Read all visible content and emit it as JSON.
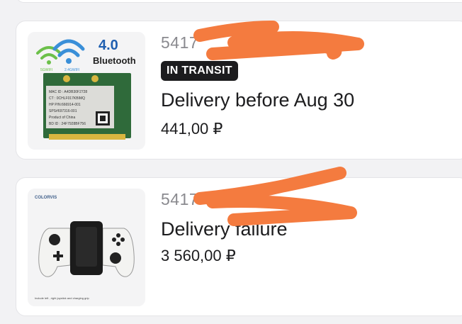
{
  "orders": [
    {
      "order_id": "5417",
      "status_badge": "IN TRANSIT",
      "delivery_text": "Delivery before Aug 30",
      "price": "441,00 ₽",
      "image": {
        "bluetooth_label": "Bluetooth",
        "bluetooth_version": "4.0",
        "wifi_5g": "5GWIFI",
        "wifi_24g": "2.4GWIFI",
        "card_lines": [
          "MAC ID : A4DB30F2728",
          "CT : 0CHLF017KBIMQ",
          "HP P/N:666914-001",
          "SPS#697316-001",
          "Product of China",
          "BD ID : 24F7928BF756"
        ]
      }
    },
    {
      "order_id": "5417",
      "delivery_text": "Delivery failure",
      "price": "3 560,00 ₽",
      "image": {
        "brand": "COLORVIS",
        "caption": "Include left , right joystick and charging grip"
      }
    }
  ],
  "colors": {
    "redaction": "#f47b3f",
    "badge_bg": "#1c1c1e"
  }
}
